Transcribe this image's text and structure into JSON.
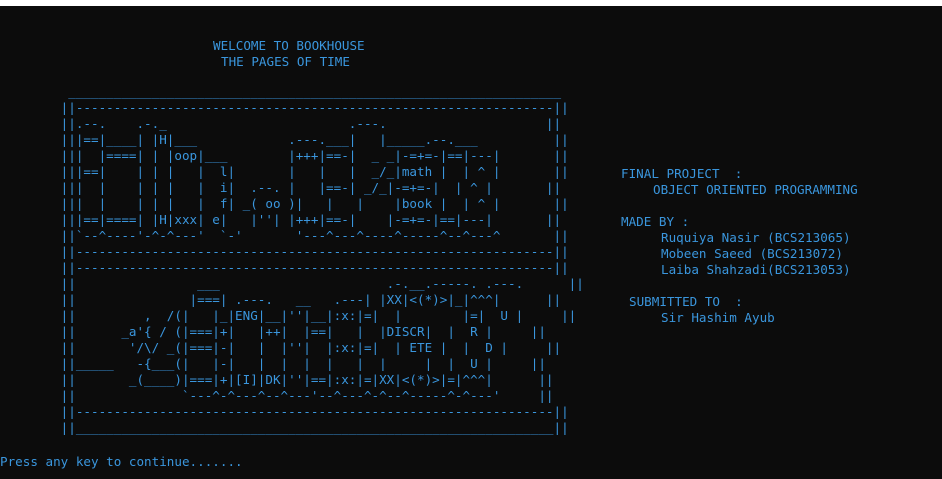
{
  "colors": {
    "background": "#0c0c0c",
    "text": "#3a96dd",
    "top_strip": "#ffffff"
  },
  "header": {
    "welcome": "WELCOME TO BOOKHOUSE",
    "tagline": "THE PAGES OF TIME"
  },
  "bookshelf_art": [
    "         _________________________________________________________________",
    "        ||---------------------------------------------------------------||",
    "        ||.--.    .-._                        .---.                     ||",
    "        |||==|____| |H|___            .---.___|   |_____.--.___          ||",
    "        |||  |====| | |oop|___        |+++|==-|  _ _|-=+=-|==|---|       ||",
    "        |||==|    | | |   |  l|       |   |   |  _/_|math |  | ^ |       ||",
    "        |||  |    | | |   |  i|  .--. |   |==-| _/_|-=+=-|  | ^ |       ||",
    "        |||  |    | | |   |  f| _( oo )|   |   |    |book |  | ^ |       ||",
    "        |||==|====| |H|xxx| e|   |''| |+++|==-|    |-=+=-|==|---|       ||",
    "        ||`--^----'-^-^---'  `-'       '---^---^----^-----^--^---^       ||",
    "        ||---------------------------------------------------------------||",
    "        ||---------------------------------------------------------------||",
    "        ||                ___                      .-.__.-----. .---.      ||",
    "        ||               |===| .---.   __   .---| |XX|<(*)>|_|^^^|      ||",
    "        ||         ,  /(|   |_|ENG|__|''|__|:x:|=|  |        |=|  U |     ||",
    "        ||      _a'{ / (|===|+|   |++|  |==|   |  |DISCR|  |  R |     ||",
    "        ||       '/\\/ _(|===|-|   |  |''|  |:x:|=|  | ETE |  |  D |     ||",
    "        ||_____   -{___(|   |-|   |  |  |  |   |  |     |  |  U |     ||",
    "        ||       _(____)|===|+|[I]|DK|''|==|:x:|=|XX|<(*)>|=|^^^|      ||",
    "        ||              `---^-^---^--^---'--^---^-^--^-----^-^---'     ||",
    "        ||---------------------------------------------------------------||",
    "        ||_______________________________________________________________||"
  ],
  "project_info": {
    "label": "FINAL PROJECT  :",
    "course": "OBJECT ORIENTED PROGRAMMING",
    "made_by_label": "MADE BY :",
    "members": [
      "Ruquiya Nasir (BCS213065)",
      "Mobeen Saeed (BCS213072)",
      "Laiba Shahzadi(BCS213053)"
    ],
    "submitted_to_label": "SUBMITTED TO  :",
    "instructor": "Sir Hashim Ayub"
  },
  "prompt": {
    "text": "Press any key to continue......."
  }
}
